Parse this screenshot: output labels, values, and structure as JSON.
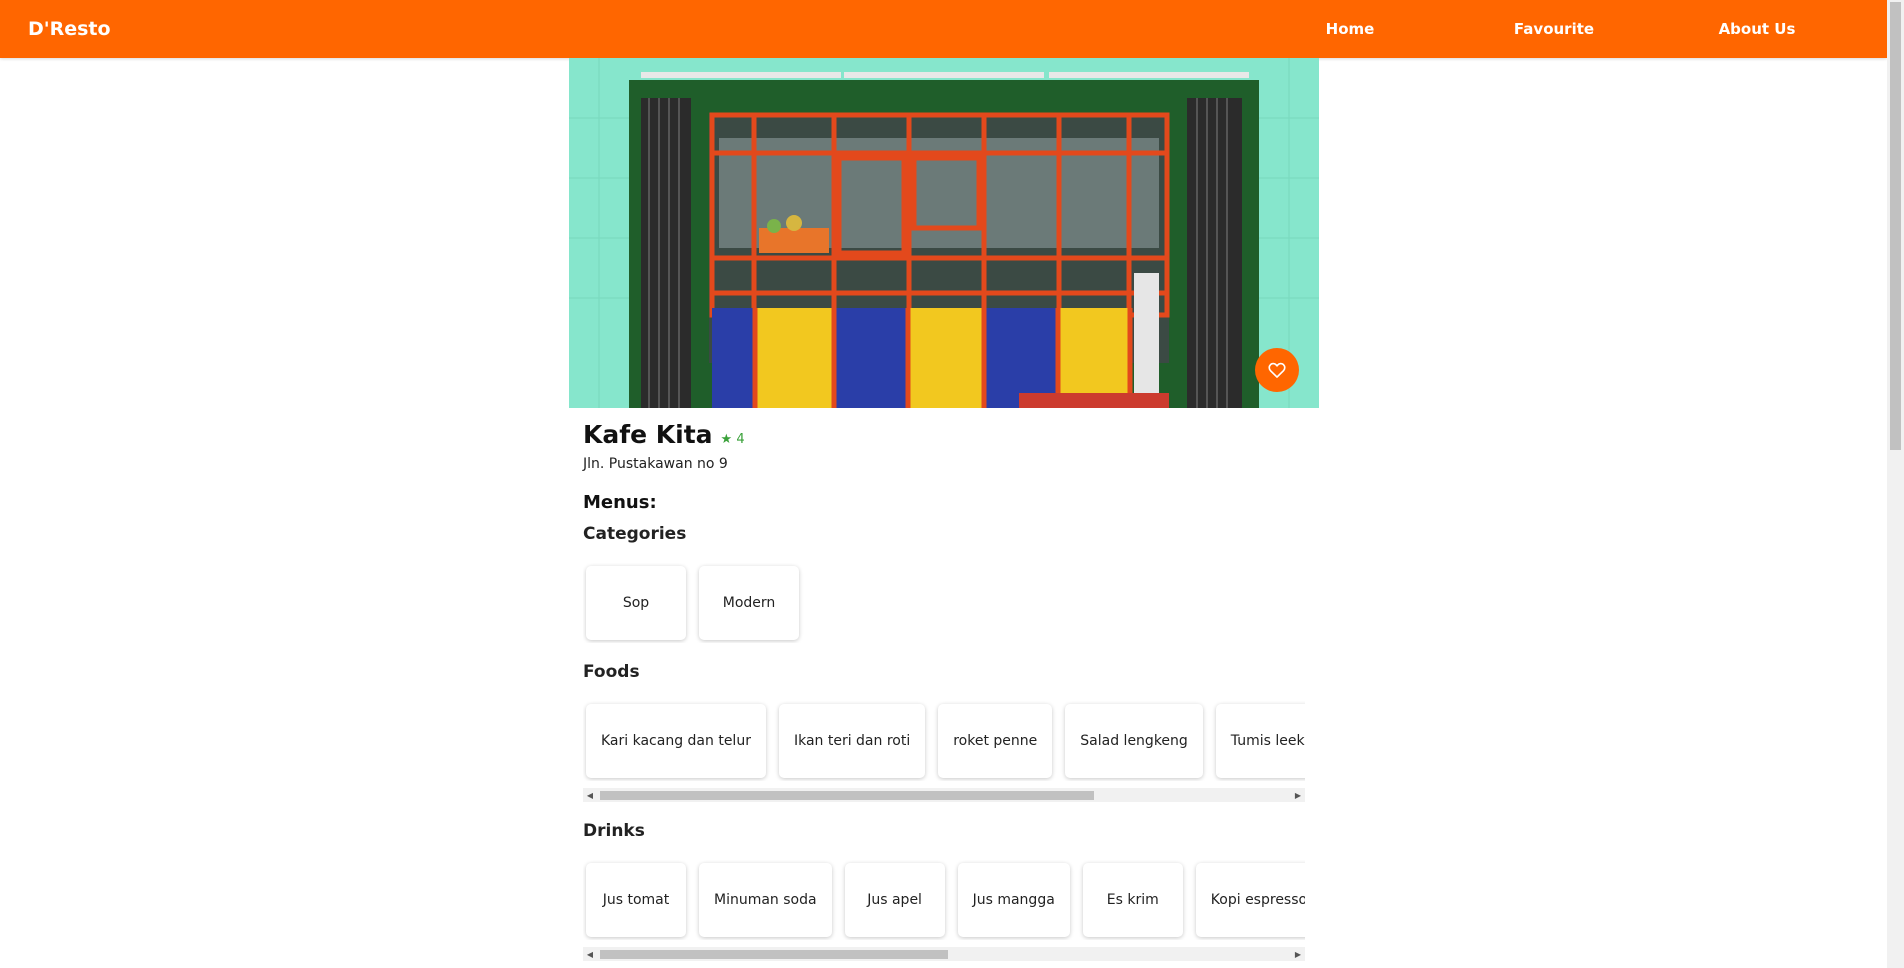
{
  "header": {
    "brand": "D'Resto",
    "nav": {
      "home": "Home",
      "favourite": "Favourite",
      "about": "About Us"
    }
  },
  "colors": {
    "accent": "#ff6600",
    "rating": "#3aa13a"
  },
  "restaurant": {
    "name": "Kafe Kita",
    "rating": "★ 4",
    "address": "Jln. Pustakawan no 9",
    "favourite_icon": "heart-outline-icon"
  },
  "menus": {
    "title": "Menus:",
    "categories": {
      "title": "Categories",
      "items": [
        "Sop",
        "Modern"
      ]
    },
    "foods": {
      "title": "Foods",
      "items": [
        "Kari kacang dan telur",
        "Ikan teri dan roti",
        "roket penne",
        "Salad lengkeng",
        "Tumis leek",
        ""
      ]
    },
    "drinks": {
      "title": "Drinks",
      "items": [
        "Jus tomat",
        "Minuman soda",
        "Jus apel",
        "Jus mangga",
        "Es krim",
        "Kopi espresso"
      ]
    }
  }
}
